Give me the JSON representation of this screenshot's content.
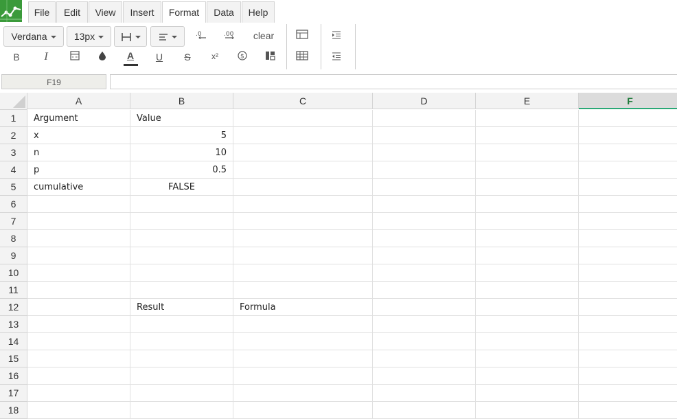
{
  "app": {
    "accent": "#3a9a3a"
  },
  "menubar": {
    "items": [
      {
        "label": "File"
      },
      {
        "label": "Edit"
      },
      {
        "label": "View"
      },
      {
        "label": "Insert"
      },
      {
        "label": "Format"
      },
      {
        "label": "Data"
      },
      {
        "label": "Help"
      }
    ],
    "active": "Format"
  },
  "toolbar": {
    "font_family": "Verdana",
    "font_size": "13px",
    "clear_label": "clear",
    "bold": "B",
    "italic": "I",
    "text_color_glyph": "A",
    "underline": "U",
    "strike": "S",
    "superscript": "x²"
  },
  "formula_bar": {
    "cell_ref": "F19",
    "value": ""
  },
  "sheet": {
    "columns": [
      "A",
      "B",
      "C",
      "D",
      "E",
      "F"
    ],
    "selected_column": "F",
    "rows": [
      "1",
      "2",
      "3",
      "4",
      "5",
      "6",
      "7",
      "8",
      "9",
      "10",
      "11",
      "12",
      "13",
      "14",
      "15",
      "16",
      "17",
      "18"
    ],
    "cells": {
      "A1": "Argument",
      "B1": "Value",
      "A2": "x",
      "B2": "5",
      "A3": "n",
      "B3": "10",
      "A4": "p",
      "B4": "0.5",
      "A5": "cumulative",
      "B5": "FALSE",
      "B12": "Result",
      "C12": "Formula"
    }
  }
}
